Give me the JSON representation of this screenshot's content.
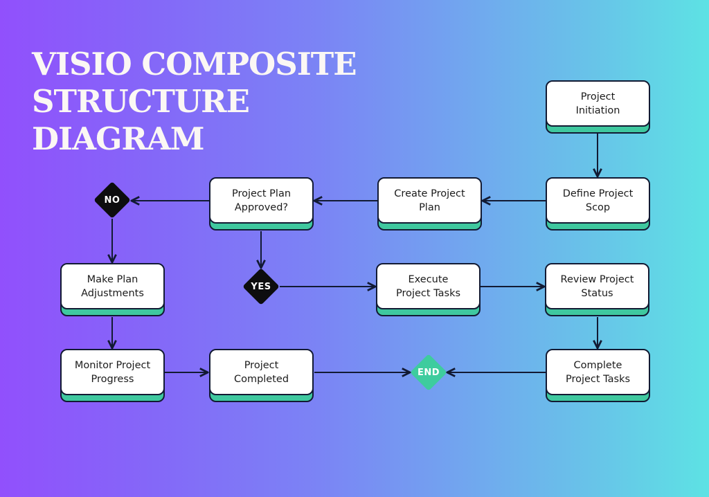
{
  "title": {
    "lines": [
      "VISIO COMPOSITE",
      "STRUCTURE",
      "DIAGRAM"
    ]
  },
  "colors": {
    "box_face": "#ffffff",
    "box_base": "#3fc89f",
    "outline": "#121a33",
    "decision": "#0d0d0f",
    "end": "#3ecc9e",
    "title_text": "#fbf7f4"
  },
  "nodes": {
    "initiation": "Project\nInitiation",
    "define_scope": "Define Project\nScop",
    "create_plan": "Create Project\nPlan",
    "plan_approved": "Project Plan\nApproved?",
    "make_adjustments": "Make Plan\nAdjustments",
    "execute_tasks": "Execute\nProject Tasks",
    "review_status": "Review Project\nStatus",
    "monitor_progress": "Monitor Project\nProgress",
    "project_completed": "Project\nCompleted",
    "complete_tasks": "Complete\nProject Tasks"
  },
  "decisions": {
    "no": "NO",
    "yes": "YES",
    "end": "END"
  },
  "edges": [
    {
      "from": "initiation",
      "to": "define_scope"
    },
    {
      "from": "define_scope",
      "to": "create_plan"
    },
    {
      "from": "create_plan",
      "to": "plan_approved"
    },
    {
      "from": "plan_approved",
      "to": "no"
    },
    {
      "from": "plan_approved",
      "to": "yes"
    },
    {
      "from": "no",
      "to": "make_adjustments"
    },
    {
      "from": "make_adjustments",
      "to": "monitor_progress"
    },
    {
      "from": "monitor_progress",
      "to": "project_completed"
    },
    {
      "from": "project_completed",
      "to": "end"
    },
    {
      "from": "yes",
      "to": "execute_tasks"
    },
    {
      "from": "execute_tasks",
      "to": "review_status"
    },
    {
      "from": "review_status",
      "to": "complete_tasks"
    },
    {
      "from": "complete_tasks",
      "to": "end"
    }
  ]
}
